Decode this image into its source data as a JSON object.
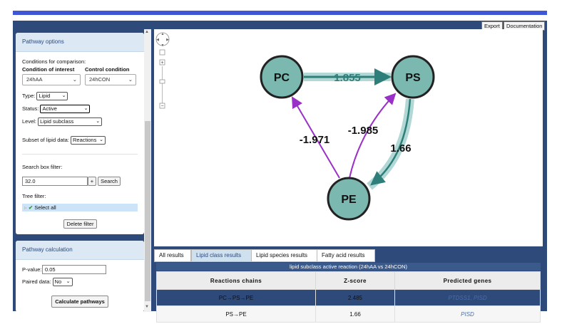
{
  "sidebar": {
    "pathway_options": {
      "title": "Pathway options",
      "conditions_label": "Conditions for comparison:",
      "interest_label": "Condition of interest",
      "control_label": "Control condition",
      "interest_value": "24hAA",
      "control_value": "24hCON",
      "type_label": "Type:",
      "type_value": "Lipid",
      "status_label": "Status:",
      "status_value": "Active",
      "level_label": "Level:",
      "level_value": "Lipid subclass",
      "subset_label": "Subset of lipid data:",
      "subset_value": "Reactions",
      "search_label": "Search box filter:",
      "search_value": "32.0",
      "plus_label": "+",
      "search_button": "Search",
      "tree_label": "Tree filter:",
      "tree_item": "Select all",
      "delete_filter": "Delete filter"
    },
    "pathway_calculation": {
      "title": "Pathway calculation",
      "pvalue_label": "P-value:",
      "pvalue_value": "0.05",
      "paired_label": "Paired data:",
      "paired_value": "No",
      "calc_button": "Calculate pathways"
    }
  },
  "toolbar": {
    "export": "Export",
    "documentation": "Documentation"
  },
  "graph": {
    "nodes": [
      "PC",
      "PS",
      "PE"
    ],
    "edges": [
      {
        "from": "PC",
        "to": "PS",
        "label": "1.855"
      },
      {
        "from": "PS",
        "to": "PE",
        "label": "1.66"
      },
      {
        "from": "PE",
        "to": "PC",
        "label": "-1.971"
      },
      {
        "from": "PE",
        "to": "PS",
        "label": "-1.985"
      }
    ],
    "colors": {
      "node_fill": "#7ab8b0",
      "node_stroke": "#222222",
      "highlight": "#a9d4d0",
      "active_edge": "#2e7f7a",
      "negative_edge": "#9b30c8"
    }
  },
  "tabs": [
    "All results",
    "Lipid class results",
    "Lipid species results",
    "Fatty acid results"
  ],
  "table": {
    "caption": "lipid subclass active reaction (24hAA vs 24hCON)",
    "headers": [
      "Reactions chains",
      "Z-score",
      "Predicted genes"
    ],
    "rows": [
      {
        "chain": "PC→PS→PE",
        "z": "2.485",
        "genes": "PTDSS1, PISD"
      },
      {
        "chain": "PS→PE",
        "z": "1.66",
        "genes": "PISD"
      }
    ]
  }
}
